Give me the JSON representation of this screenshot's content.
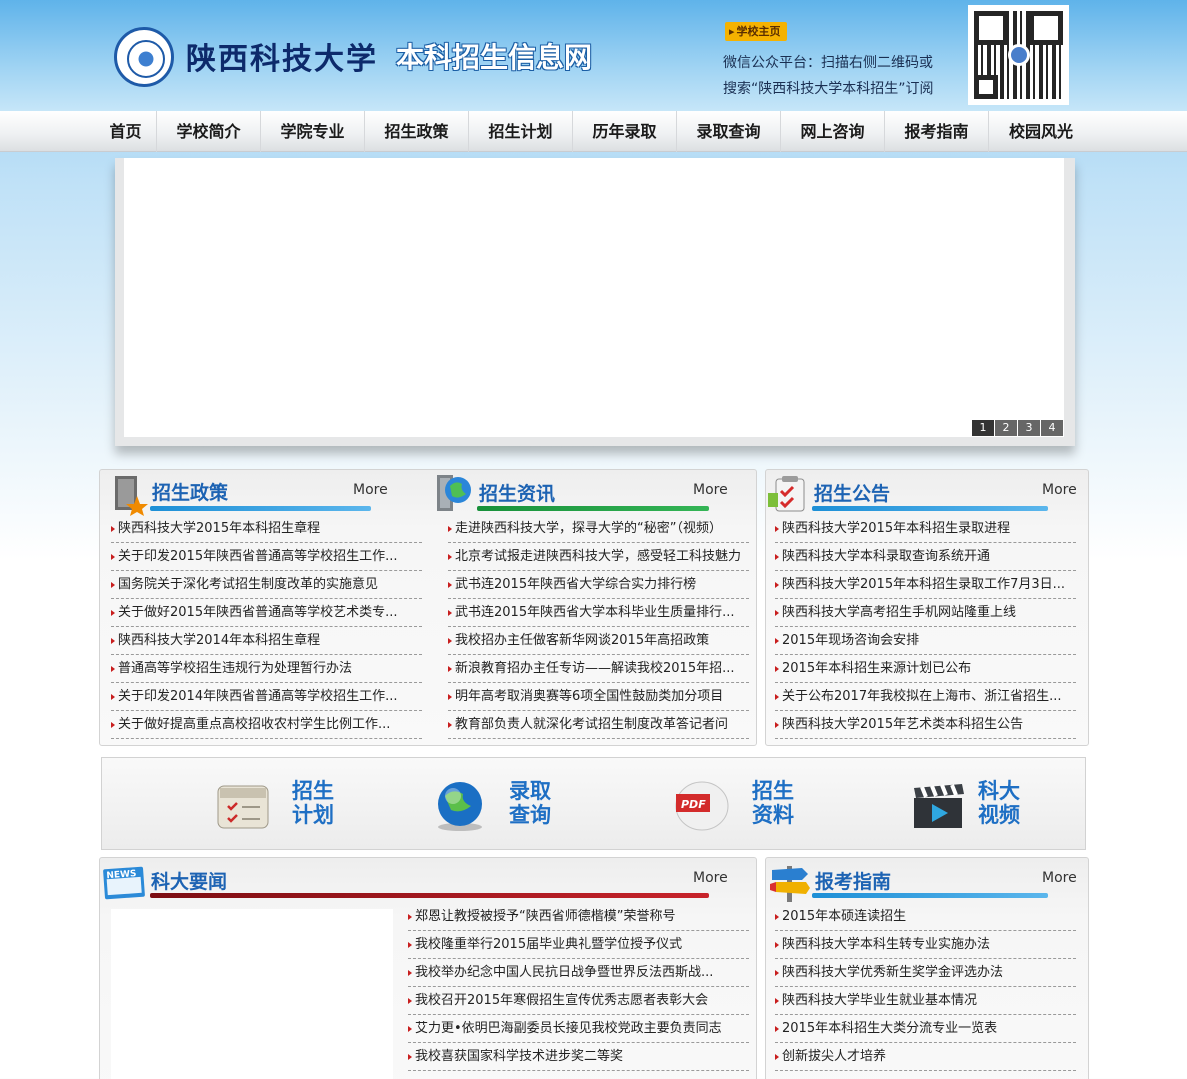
{
  "header": {
    "logo_calligraphy": "陕西科技大学",
    "site_title": "本科招生信息网",
    "home_button": "学校主页",
    "wechat_line1": "微信公众平台：扫描右侧二维码或",
    "wechat_line2": "搜索“陕西科技大学本科招生”订阅"
  },
  "nav": {
    "items": [
      "首页",
      "学校简介",
      "学院专业",
      "招生政策",
      "招生计划",
      "历年录取",
      "录取查询",
      "网上咨询",
      "报考指南",
      "校园风光"
    ]
  },
  "banner": {
    "pages": [
      "1",
      "2",
      "3",
      "4"
    ]
  },
  "policy": {
    "title": "招生政策",
    "more": "More",
    "items": [
      "陕西科技大学2015年本科招生章程",
      "关于印发2015年陕西省普通高等学校招生工作...",
      "国务院关于深化考试招生制度改革的实施意见",
      "关于做好2015年陕西省普通高等学校艺术类专...",
      "陕西科技大学2014年本科招生章程",
      "普通高等学校招生违规行为处理暂行办法",
      "关于印发2014年陕西省普通高等学校招生工作...",
      "关于做好提高重点高校招收农村学生比例工作..."
    ]
  },
  "info": {
    "title": "招生资讯",
    "more": "More",
    "items": [
      "走进陕西科技大学，探寻大学的“秘密”（视频）",
      "北京考试报走进陕西科技大学，感受轻工科技魅力",
      "武书连2015年陕西省大学综合实力排行榜",
      "武书连2015年陕西省大学本科毕业生质量排行...",
      "我校招办主任做客新华网谈2015年高招政策",
      "新浪教育招办主任专访——解读我校2015年招...",
      "明年高考取消奥赛等6项全国性鼓励类加分项目",
      "教育部负责人就深化考试招生制度改革答记者问"
    ]
  },
  "notice": {
    "title": "招生公告",
    "more": "More",
    "items": [
      "陕西科技大学2015年本科招生录取进程",
      "陕西科技大学本科录取查询系统开通",
      "陕西科技大学2015年本科招生录取工作7月3日...",
      "陕西科技大学高考招生手机网站隆重上线",
      "2015年现场咨询会安排",
      "2015年本科招生来源计划已公布",
      "关于公布2017年我校拟在上海市、浙江省招生...",
      "陕西科技大学2015年艺术类本科招生公告"
    ]
  },
  "quick_links": [
    {
      "line1": "招生",
      "line2": "计划",
      "icon": "calendar-check-icon"
    },
    {
      "line1": "录取",
      "line2": "查询",
      "icon": "globe-icon"
    },
    {
      "line1": "招生",
      "line2": "资料",
      "icon": "pdf-icon"
    },
    {
      "line1": "科大",
      "line2": "视频",
      "icon": "clapperboard-icon"
    }
  ],
  "news": {
    "title": "科大要闻",
    "more": "More",
    "badge": "NEWS",
    "items": [
      "郑恩让教授被授予“陕西省师德楷模”荣誉称号",
      "我校隆重举行2015届毕业典礼暨学位授予仪式",
      "我校举办纪念中国人民抗日战争暨世界反法西斯战...",
      "我校召开2015年寒假招生宣传优秀志愿者表彰大会",
      "艾力更•依明巴海副委员长接见我校党政主要负责同志",
      "我校喜获国家科学技术进步奖二等奖"
    ]
  },
  "guide": {
    "title": "报考指南",
    "more": "More",
    "items": [
      "2015年本硕连读招生",
      "陕西科技大学本科生转专业实施办法",
      "陕西科技大学优秀新生奖学金评选办法",
      "陕西科技大学毕业生就业基本情况",
      "2015年本科招生大类分流专业一览表",
      "创新拔尖人才培养"
    ]
  },
  "colors": {
    "title_blue": "#1d63b3",
    "bullet_red": "#c81e1e",
    "line_blue": "#1d8fd6",
    "line_green": "#21a046",
    "line_red": "#a8141b"
  }
}
